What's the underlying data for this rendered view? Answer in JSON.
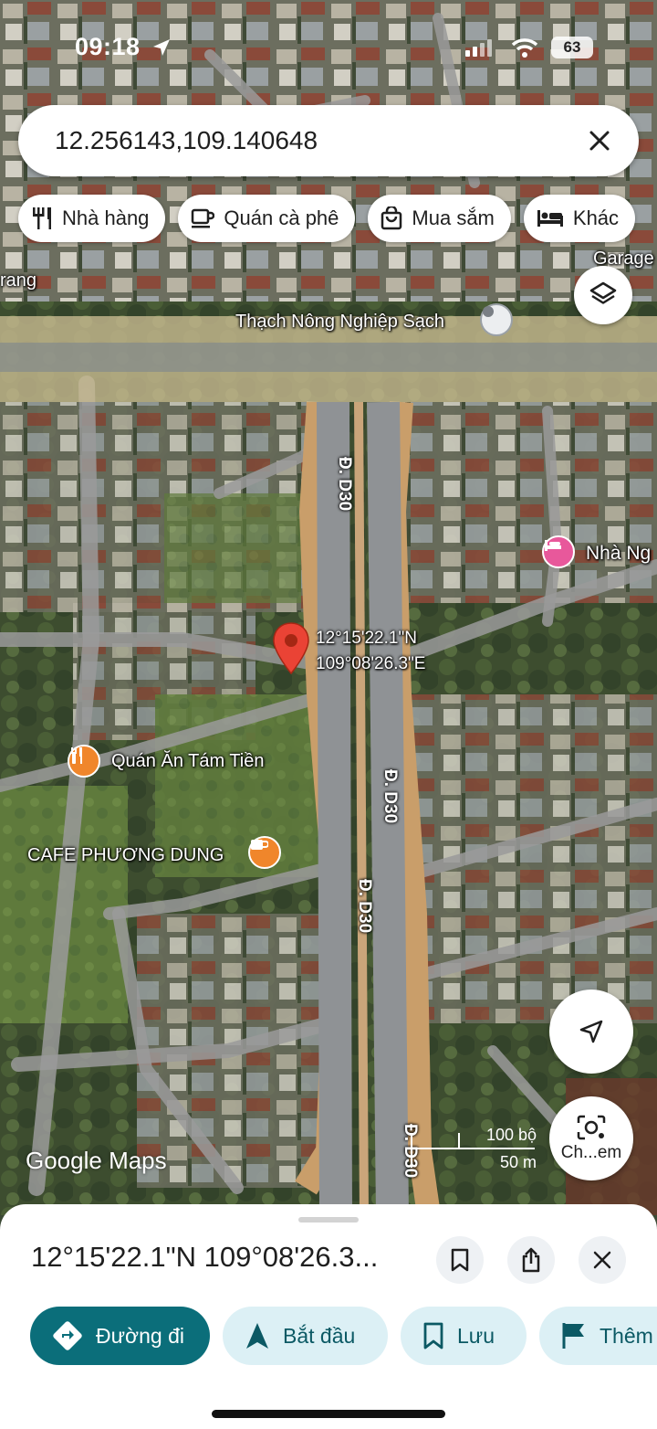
{
  "status_bar": {
    "time": "09:18",
    "battery": "63",
    "icons": [
      "location-arrow-icon",
      "signal-icon",
      "wifi-icon",
      "battery-icon"
    ]
  },
  "search": {
    "query": "12.256143,109.140648",
    "clear_icon": "close-icon"
  },
  "chips": [
    {
      "label": "Nhà hàng",
      "icon": "restaurant-icon"
    },
    {
      "label": "Quán cà phê",
      "icon": "coffee-icon"
    },
    {
      "label": "Mua sắm",
      "icon": "shopping-bag-icon"
    },
    {
      "label": "Khác",
      "icon": "bed-icon"
    }
  ],
  "map": {
    "labels": {
      "garage": "Garage",
      "trang": "rang",
      "thach": "Thạch Nông Nghiệp Sạch",
      "nha_nghi": "Nhà Ng",
      "quan_an": "Quán Ăn Tám Tiền",
      "cafe": "CAFE PHƯƠNG DUNG"
    },
    "road_label": "Đ. D30",
    "pin_coords": {
      "lat": "12°15'22.1\"N",
      "lng": "109°08'26.3\"E"
    },
    "scale": {
      "imperial": "100 bộ",
      "metric": "50 m"
    },
    "attribution": "Google Maps",
    "lens_label": "Ch...em",
    "colors": {
      "pin_red": "#ea4335",
      "poi_orange": "#f0862b",
      "poi_pink": "#e8589b",
      "road": "#9a9a9a"
    }
  },
  "sheet": {
    "title": "12°15'22.1\"N 109°08'26.3...",
    "icons": [
      "bookmark-icon",
      "share-icon",
      "close-icon"
    ],
    "actions": [
      {
        "label": "Đường đi",
        "icon": "directions-icon"
      },
      {
        "label": "Bắt đầu",
        "icon": "navigation-arrow-icon"
      },
      {
        "label": "Lưu",
        "icon": "bookmark-icon"
      },
      {
        "label": "Thêm",
        "icon": "flag-icon"
      }
    ],
    "colors": {
      "primary": "#0b6e7a",
      "secondary_bg": "#dcf0f5"
    }
  }
}
